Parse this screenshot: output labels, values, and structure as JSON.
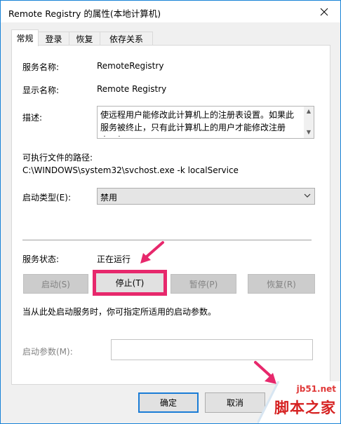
{
  "window": {
    "title": "Remote Registry 的属性(本地计算机)"
  },
  "tabs": [
    {
      "label": "常规",
      "active": true
    },
    {
      "label": "登录",
      "active": false
    },
    {
      "label": "恢复",
      "active": false
    },
    {
      "label": "依存关系",
      "active": false
    }
  ],
  "general": {
    "service_name_label": "服务名称:",
    "service_name_value": "RemoteRegistry",
    "display_name_label": "显示名称:",
    "display_name_value": "Remote Registry",
    "description_label": "描述:",
    "description_value": "使远程用户能修改此计算机上的注册表设置。如果此服务被终止，只有此计算机上的用户才能修改注册表。如",
    "exe_path_label": "可执行文件的路径:",
    "exe_path_value": "C:\\WINDOWS\\system32\\svchost.exe -k localService",
    "startup_type_label": "启动类型(E):",
    "startup_type_value": "禁用",
    "service_status_label": "服务状态:",
    "service_status_value": "正在运行",
    "hint_text": "当从此处启动服务时，你可指定所适用的启动参数。",
    "start_params_label": "启动参数(M):"
  },
  "service_buttons": {
    "start": "启动(S)",
    "stop": "停止(T)",
    "pause": "暂停(P)",
    "resume": "恢复(R)"
  },
  "dialog_buttons": {
    "ok": "确定",
    "cancel": "取消"
  },
  "watermark": {
    "url": "jb51.net",
    "site": "脚本之家"
  },
  "colors": {
    "accent": "#1883d7",
    "highlight": "#e7286c",
    "annotation_arrow": "#e7286c"
  },
  "icons": [
    "close-icon",
    "chevron-down-icon",
    "scroll-up-icon",
    "scroll-down-icon",
    "annotation-arrow-icon"
  ]
}
